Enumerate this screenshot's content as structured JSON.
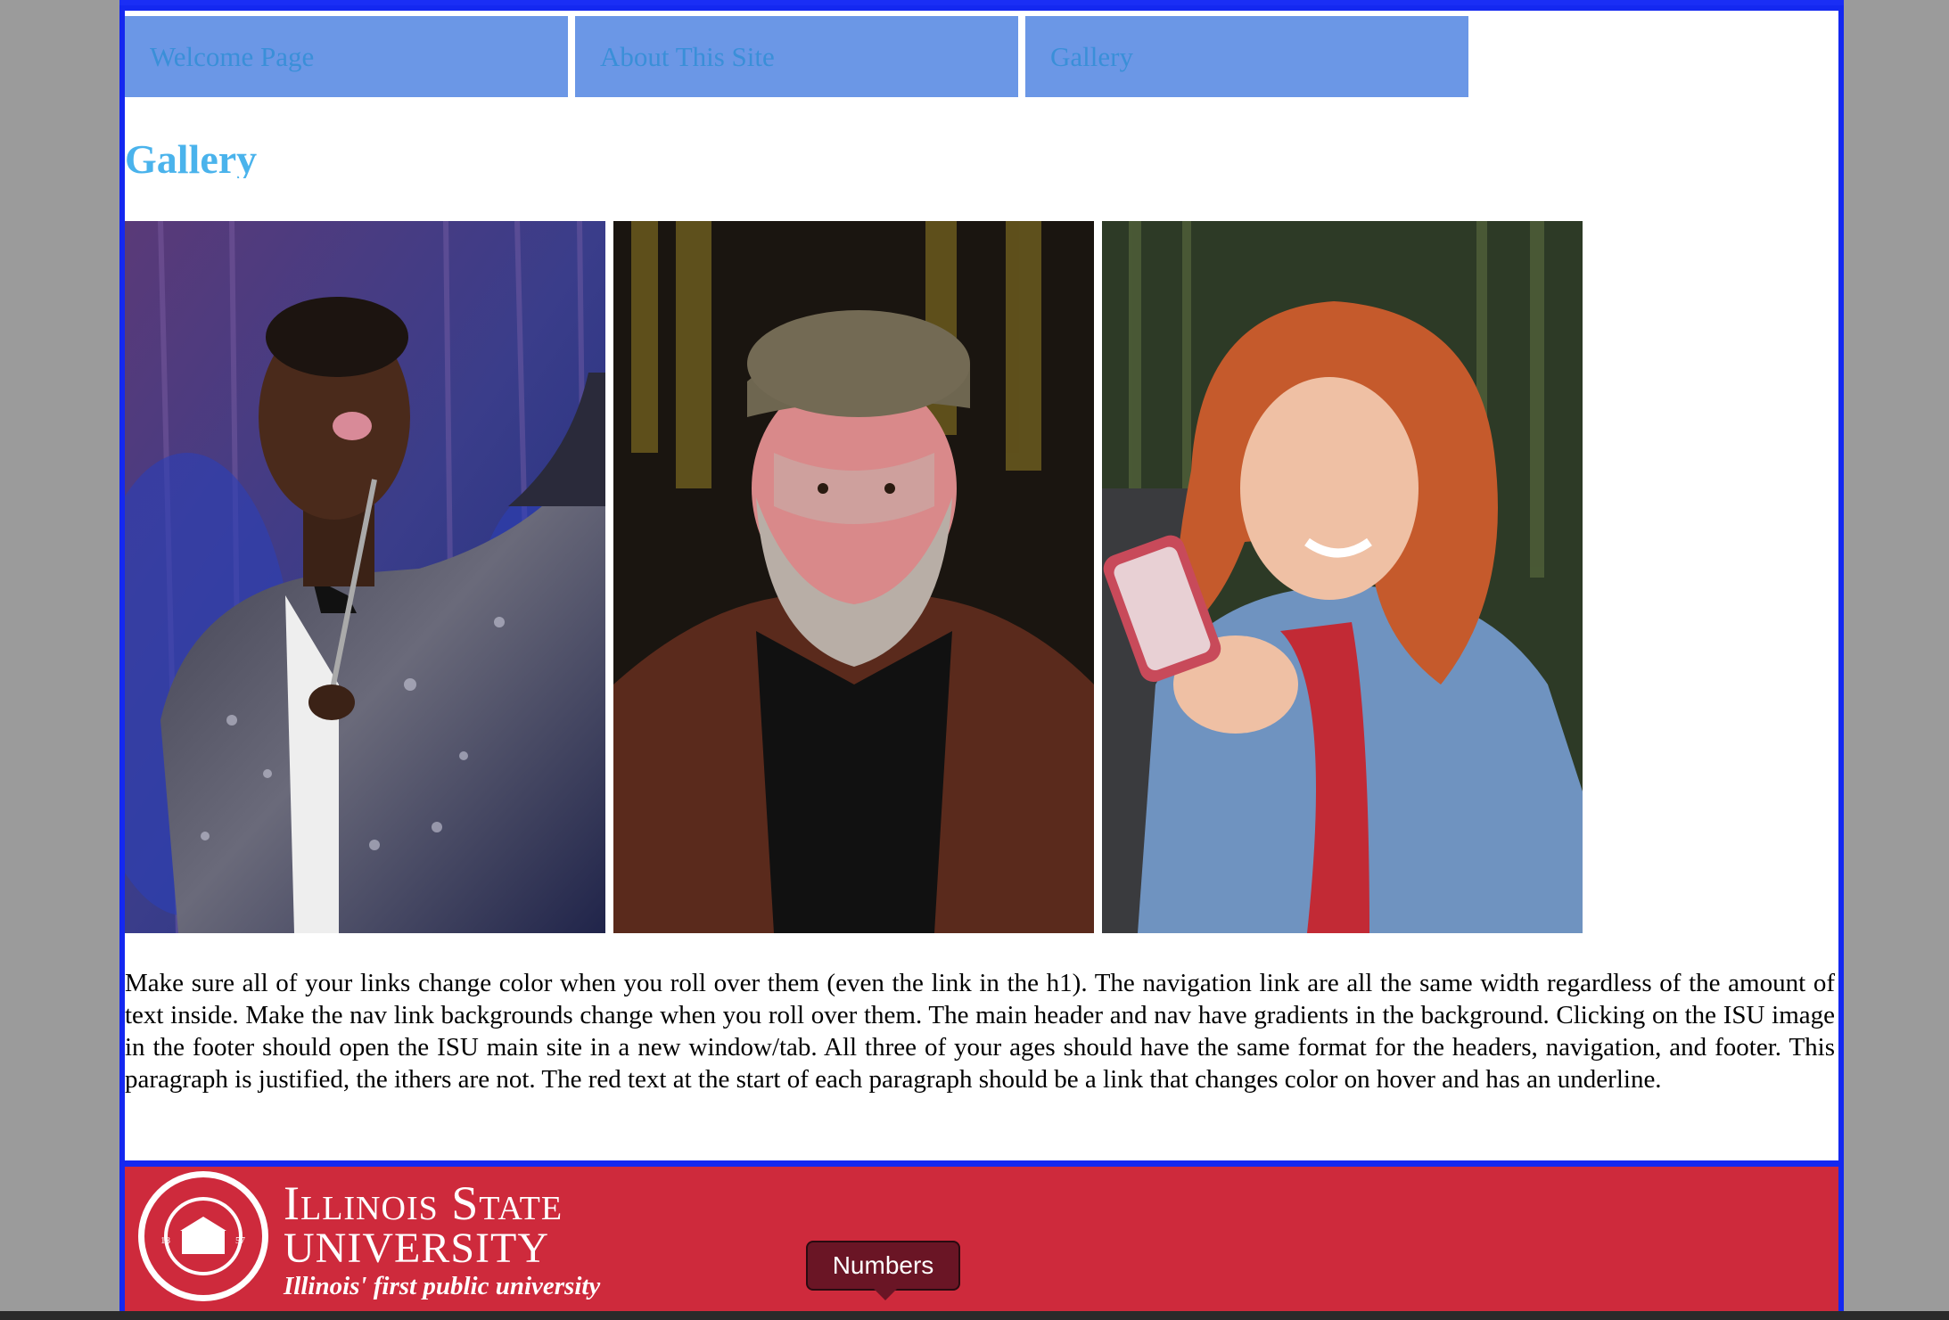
{
  "nav": {
    "items": [
      {
        "label": "Welcome Page"
      },
      {
        "label": "About This Site"
      },
      {
        "label": "Gallery"
      }
    ]
  },
  "page_title": "Gallery",
  "gallery": {
    "images": [
      {
        "subject": "singer-in-sequin-jacket"
      },
      {
        "subject": "bearded-man-in-cap"
      },
      {
        "subject": "woman-with-phone"
      }
    ]
  },
  "paragraph": "Make sure all of your links change color when you roll over them (even the link in the h1). The navigation link are all the same width regardless of the amount of text inside. Make the nav link backgrounds change when you roll over them. The main header and nav have gradients in the background. Clicking on the ISU image in the footer should open the ISU main site in a new window/tab. All three of your ages should have the same format for the headers, navigation, and footer. This paragraph is justified, the ithers are not. The red text at the start of each paragraph should be a link that changes color on hover and has an underline.",
  "footer": {
    "logo_line1": "Illinois State",
    "logo_line2": "UNIVERSITY",
    "tagline": "Illinois' first public university",
    "seal_text": "ILLINOIS STATE UNIVERSITY"
  },
  "tooltip": {
    "label": "Numbers"
  },
  "colors": {
    "border": "#1428f0",
    "nav_bg": "#6b97e6",
    "nav_text": "#3a8fd8",
    "title": "#4ab3ec",
    "footer_bg": "#ce2a3c",
    "tooltip_bg": "#6a1525"
  }
}
